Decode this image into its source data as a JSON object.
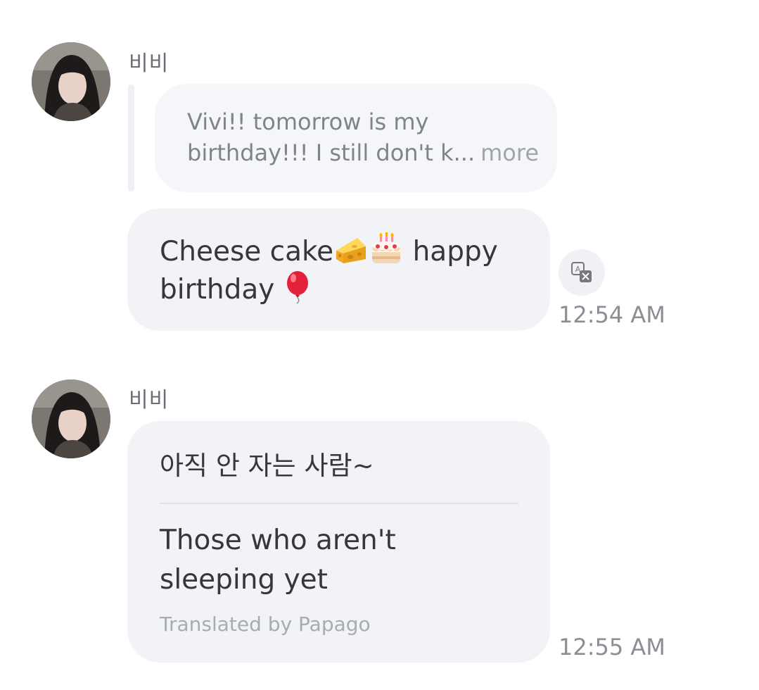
{
  "messages": [
    {
      "sender": "비비",
      "avatar_icon": "user-avatar",
      "reply_preview": {
        "line1": "Vivi!! tomorrow is my",
        "line2": "birthday!!! I still don't k...",
        "more_label": "more"
      },
      "text_line1": "Cheese cake",
      "text_line1_end": "happy",
      "text_line2": "birthday",
      "emojis": [
        "cheese-wedge-icon",
        "birthday-cake-icon",
        "balloon-icon"
      ],
      "translate_icon": "translate-icon",
      "time": "12:54 AM"
    },
    {
      "sender": "비비",
      "avatar_icon": "user-avatar",
      "original_text": "아직 안 자는 사람~",
      "translation_line1": "Those who aren't",
      "translation_line2": "sleeping yet",
      "translated_by": "Translated by Papago",
      "time": "12:55 AM"
    }
  ],
  "colors": {
    "bubble": "#f2f3f6",
    "text": "#35363e",
    "muted": "#8c8e96"
  }
}
